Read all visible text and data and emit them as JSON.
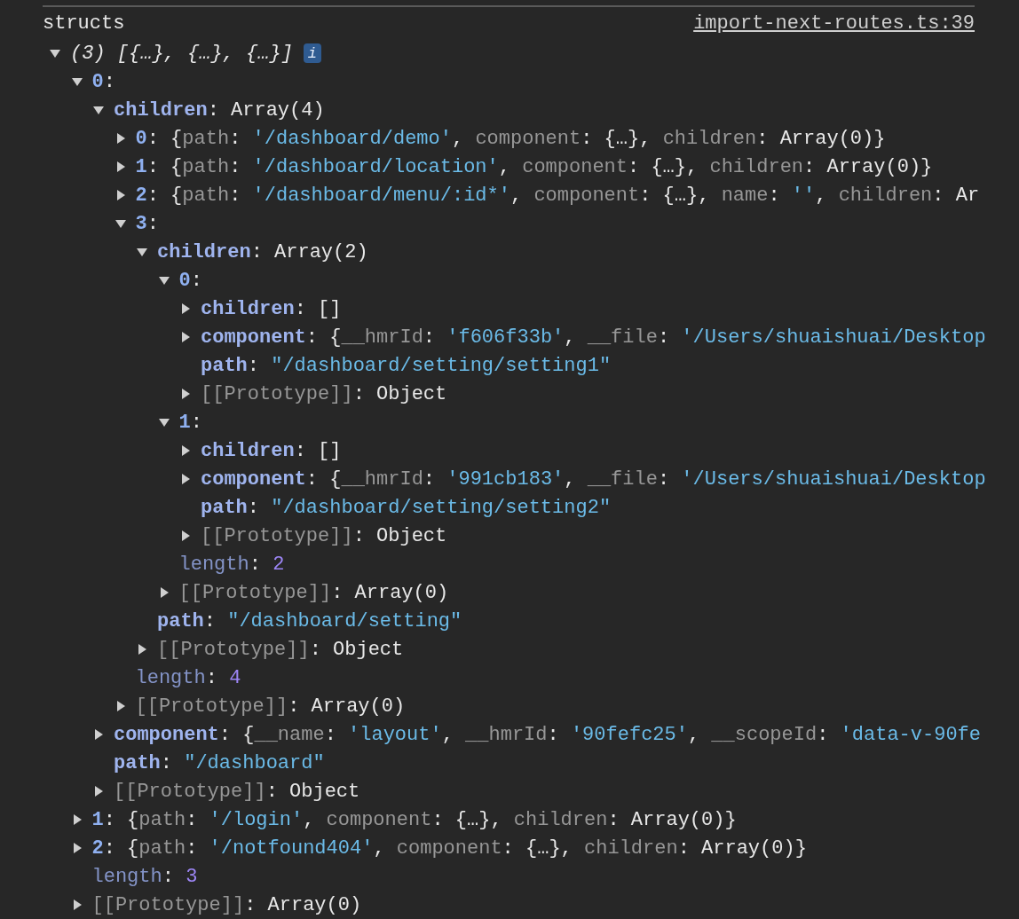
{
  "log": {
    "label": "structs",
    "source": "import-next-routes.ts:39"
  },
  "tree": {
    "expanded": true,
    "badge": "i",
    "tokens": [
      {
        "kind": "italic",
        "text": "(3) [{…}, {…}, {…}]"
      }
    ],
    "children": [
      {
        "expanded": true,
        "tokens": [
          {
            "kind": "index",
            "text": "0"
          },
          {
            "kind": "plain",
            "text": ":"
          }
        ],
        "children": [
          {
            "expanded": true,
            "tokens": [
              {
                "kind": "key",
                "text": "children"
              },
              {
                "kind": "plain",
                "text": ": Array(4)"
              }
            ],
            "children": [
              {
                "expanded": false,
                "tokens": [
                  {
                    "kind": "index",
                    "text": "0"
                  },
                  {
                    "kind": "plain",
                    "text": ": {"
                  },
                  {
                    "kind": "dim",
                    "text": "path"
                  },
                  {
                    "kind": "plain",
                    "text": ": "
                  },
                  {
                    "kind": "string",
                    "text": "'/dashboard/demo'"
                  },
                  {
                    "kind": "plain",
                    "text": ", "
                  },
                  {
                    "kind": "dim",
                    "text": "component"
                  },
                  {
                    "kind": "plain",
                    "text": ": {…}, "
                  },
                  {
                    "kind": "dim",
                    "text": "children"
                  },
                  {
                    "kind": "plain",
                    "text": ": Array(0)}"
                  }
                ]
              },
              {
                "expanded": false,
                "tokens": [
                  {
                    "kind": "index",
                    "text": "1"
                  },
                  {
                    "kind": "plain",
                    "text": ": {"
                  },
                  {
                    "kind": "dim",
                    "text": "path"
                  },
                  {
                    "kind": "plain",
                    "text": ": "
                  },
                  {
                    "kind": "string",
                    "text": "'/dashboard/location'"
                  },
                  {
                    "kind": "plain",
                    "text": ", "
                  },
                  {
                    "kind": "dim",
                    "text": "component"
                  },
                  {
                    "kind": "plain",
                    "text": ": {…}, "
                  },
                  {
                    "kind": "dim",
                    "text": "children"
                  },
                  {
                    "kind": "plain",
                    "text": ": Array(0)}"
                  }
                ]
              },
              {
                "expanded": false,
                "tokens": [
                  {
                    "kind": "index",
                    "text": "2"
                  },
                  {
                    "kind": "plain",
                    "text": ": {"
                  },
                  {
                    "kind": "dim",
                    "text": "path"
                  },
                  {
                    "kind": "plain",
                    "text": ": "
                  },
                  {
                    "kind": "string",
                    "text": "'/dashboard/menu/:id*'"
                  },
                  {
                    "kind": "plain",
                    "text": ", "
                  },
                  {
                    "kind": "dim",
                    "text": "component"
                  },
                  {
                    "kind": "plain",
                    "text": ": {…}, "
                  },
                  {
                    "kind": "dim",
                    "text": "name"
                  },
                  {
                    "kind": "plain",
                    "text": ": "
                  },
                  {
                    "kind": "string",
                    "text": "''"
                  },
                  {
                    "kind": "plain",
                    "text": ", "
                  },
                  {
                    "kind": "dim",
                    "text": "children"
                  },
                  {
                    "kind": "plain",
                    "text": ": Ar"
                  }
                ]
              },
              {
                "expanded": true,
                "tokens": [
                  {
                    "kind": "index",
                    "text": "3"
                  },
                  {
                    "kind": "plain",
                    "text": ":"
                  }
                ],
                "children": [
                  {
                    "expanded": true,
                    "tokens": [
                      {
                        "kind": "key",
                        "text": "children"
                      },
                      {
                        "kind": "plain",
                        "text": ": Array(2)"
                      }
                    ],
                    "children": [
                      {
                        "expanded": true,
                        "tokens": [
                          {
                            "kind": "index",
                            "text": "0"
                          },
                          {
                            "kind": "plain",
                            "text": ":"
                          }
                        ],
                        "children": [
                          {
                            "expanded": false,
                            "tokens": [
                              {
                                "kind": "key",
                                "text": "children"
                              },
                              {
                                "kind": "plain",
                                "text": ": []"
                              }
                            ]
                          },
                          {
                            "expanded": false,
                            "tokens": [
                              {
                                "kind": "key",
                                "text": "component"
                              },
                              {
                                "kind": "plain",
                                "text": ": {"
                              },
                              {
                                "kind": "dim",
                                "text": "__hmrId"
                              },
                              {
                                "kind": "plain",
                                "text": ": "
                              },
                              {
                                "kind": "string",
                                "text": "'f606f33b'"
                              },
                              {
                                "kind": "plain",
                                "text": ", "
                              },
                              {
                                "kind": "dim",
                                "text": "__file"
                              },
                              {
                                "kind": "plain",
                                "text": ": "
                              },
                              {
                                "kind": "string",
                                "text": "'/Users/shuaishuai/Desktop"
                              }
                            ]
                          },
                          {
                            "tokens": [
                              {
                                "kind": "key",
                                "text": "path"
                              },
                              {
                                "kind": "plain",
                                "text": ": "
                              },
                              {
                                "kind": "string",
                                "text": "\"/dashboard/setting/setting1\""
                              }
                            ]
                          },
                          {
                            "expanded": false,
                            "tokens": [
                              {
                                "kind": "dim",
                                "text": "[[Prototype]]"
                              },
                              {
                                "kind": "plain",
                                "text": ": Object"
                              }
                            ]
                          }
                        ]
                      },
                      {
                        "expanded": true,
                        "tokens": [
                          {
                            "kind": "index",
                            "text": "1"
                          },
                          {
                            "kind": "plain",
                            "text": ":"
                          }
                        ],
                        "children": [
                          {
                            "expanded": false,
                            "tokens": [
                              {
                                "kind": "key",
                                "text": "children"
                              },
                              {
                                "kind": "plain",
                                "text": ": []"
                              }
                            ]
                          },
                          {
                            "expanded": false,
                            "tokens": [
                              {
                                "kind": "key",
                                "text": "component"
                              },
                              {
                                "kind": "plain",
                                "text": ": {"
                              },
                              {
                                "kind": "dim",
                                "text": "__hmrId"
                              },
                              {
                                "kind": "plain",
                                "text": ": "
                              },
                              {
                                "kind": "string",
                                "text": "'991cb183'"
                              },
                              {
                                "kind": "plain",
                                "text": ", "
                              },
                              {
                                "kind": "dim",
                                "text": "__file"
                              },
                              {
                                "kind": "plain",
                                "text": ": "
                              },
                              {
                                "kind": "string",
                                "text": "'/Users/shuaishuai/Desktop"
                              }
                            ]
                          },
                          {
                            "tokens": [
                              {
                                "kind": "key",
                                "text": "path"
                              },
                              {
                                "kind": "plain",
                                "text": ": "
                              },
                              {
                                "kind": "string",
                                "text": "\"/dashboard/setting/setting2\""
                              }
                            ]
                          },
                          {
                            "expanded": false,
                            "tokens": [
                              {
                                "kind": "dim",
                                "text": "[[Prototype]]"
                              },
                              {
                                "kind": "plain",
                                "text": ": Object"
                              }
                            ]
                          }
                        ]
                      },
                      {
                        "tokens": [
                          {
                            "kind": "meta",
                            "text": "length"
                          },
                          {
                            "kind": "plain",
                            "text": ": "
                          },
                          {
                            "kind": "number",
                            "text": "2"
                          }
                        ]
                      },
                      {
                        "expanded": false,
                        "tokens": [
                          {
                            "kind": "dim",
                            "text": "[[Prototype]]"
                          },
                          {
                            "kind": "plain",
                            "text": ": Array(0)"
                          }
                        ]
                      }
                    ]
                  },
                  {
                    "tokens": [
                      {
                        "kind": "key",
                        "text": "path"
                      },
                      {
                        "kind": "plain",
                        "text": ": "
                      },
                      {
                        "kind": "string",
                        "text": "\"/dashboard/setting\""
                      }
                    ]
                  },
                  {
                    "expanded": false,
                    "tokens": [
                      {
                        "kind": "dim",
                        "text": "[[Prototype]]"
                      },
                      {
                        "kind": "plain",
                        "text": ": Object"
                      }
                    ]
                  }
                ]
              },
              {
                "tokens": [
                  {
                    "kind": "meta",
                    "text": "length"
                  },
                  {
                    "kind": "plain",
                    "text": ": "
                  },
                  {
                    "kind": "number",
                    "text": "4"
                  }
                ]
              },
              {
                "expanded": false,
                "tokens": [
                  {
                    "kind": "dim",
                    "text": "[[Prototype]]"
                  },
                  {
                    "kind": "plain",
                    "text": ": Array(0)"
                  }
                ]
              }
            ]
          },
          {
            "expanded": false,
            "tokens": [
              {
                "kind": "key",
                "text": "component"
              },
              {
                "kind": "plain",
                "text": ": {"
              },
              {
                "kind": "dim",
                "text": "__name"
              },
              {
                "kind": "plain",
                "text": ": "
              },
              {
                "kind": "string",
                "text": "'layout'"
              },
              {
                "kind": "plain",
                "text": ", "
              },
              {
                "kind": "dim",
                "text": "__hmrId"
              },
              {
                "kind": "plain",
                "text": ": "
              },
              {
                "kind": "string",
                "text": "'90fefc25'"
              },
              {
                "kind": "plain",
                "text": ", "
              },
              {
                "kind": "dim",
                "text": "__scopeId"
              },
              {
                "kind": "plain",
                "text": ": "
              },
              {
                "kind": "string",
                "text": "'data-v-90fe"
              }
            ]
          },
          {
            "tokens": [
              {
                "kind": "key",
                "text": "path"
              },
              {
                "kind": "plain",
                "text": ": "
              },
              {
                "kind": "string",
                "text": "\"/dashboard\""
              }
            ]
          },
          {
            "expanded": false,
            "tokens": [
              {
                "kind": "dim",
                "text": "[[Prototype]]"
              },
              {
                "kind": "plain",
                "text": ": Object"
              }
            ]
          }
        ]
      },
      {
        "expanded": false,
        "tokens": [
          {
            "kind": "index",
            "text": "1"
          },
          {
            "kind": "plain",
            "text": ": {"
          },
          {
            "kind": "dim",
            "text": "path"
          },
          {
            "kind": "plain",
            "text": ": "
          },
          {
            "kind": "string",
            "text": "'/login'"
          },
          {
            "kind": "plain",
            "text": ", "
          },
          {
            "kind": "dim",
            "text": "component"
          },
          {
            "kind": "plain",
            "text": ": {…}, "
          },
          {
            "kind": "dim",
            "text": "children"
          },
          {
            "kind": "plain",
            "text": ": Array(0)}"
          }
        ]
      },
      {
        "expanded": false,
        "tokens": [
          {
            "kind": "index",
            "text": "2"
          },
          {
            "kind": "plain",
            "text": ": {"
          },
          {
            "kind": "dim",
            "text": "path"
          },
          {
            "kind": "plain",
            "text": ": "
          },
          {
            "kind": "string",
            "text": "'/notfound404'"
          },
          {
            "kind": "plain",
            "text": ", "
          },
          {
            "kind": "dim",
            "text": "component"
          },
          {
            "kind": "plain",
            "text": ": {…}, "
          },
          {
            "kind": "dim",
            "text": "children"
          },
          {
            "kind": "plain",
            "text": ": Array(0)}"
          }
        ]
      },
      {
        "tokens": [
          {
            "kind": "meta",
            "text": "length"
          },
          {
            "kind": "plain",
            "text": ": "
          },
          {
            "kind": "number",
            "text": "3"
          }
        ]
      },
      {
        "expanded": false,
        "tokens": [
          {
            "kind": "dim",
            "text": "[[Prototype]]"
          },
          {
            "kind": "plain",
            "text": ": Array(0)"
          }
        ]
      }
    ]
  }
}
